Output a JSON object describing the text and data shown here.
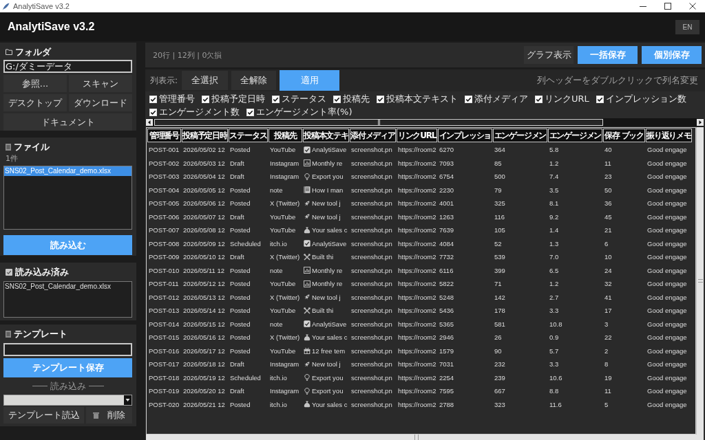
{
  "window": {
    "title": "AnalytiSave v3.2"
  },
  "header": {
    "title": "AnalytiSave v3.2",
    "language_button": "EN"
  },
  "sidebar": {
    "folder_panel": {
      "title": "フォルダ",
      "path": "G:/ダミーデータ",
      "buttons": [
        "参照...",
        "スキャン",
        "デスクトップ",
        "ダウンロード",
        "ドキュメント"
      ]
    },
    "file_panel": {
      "title": "ファイル",
      "count": "1件",
      "files": [
        {
          "name": "SNS02_Post_Calendar_demo.xlsx",
          "selected": true
        }
      ],
      "load_button": "読み込む"
    },
    "loaded_panel": {
      "title": "読み込み済み",
      "files": [
        "SNS02_Post_Calendar_demo.xlsx"
      ]
    },
    "template_panel": {
      "title": "テンプレート",
      "save_button": "テンプレート保存",
      "divider_label": "読み込み",
      "template_select": {
        "disabled": true
      },
      "load_button": "テンプレート読込",
      "delete_button": "削除"
    }
  },
  "summary": "20行 | 12列 | 0欠損",
  "toolbar_buttons": [
    {
      "label": "グラフ表示",
      "primary": false
    },
    {
      "label": "一括保存",
      "primary": true
    },
    {
      "label": "個別保存",
      "primary": true
    }
  ],
  "column_bar": {
    "label": "列表示:",
    "buttons": [
      {
        "label": "全選択",
        "primary": false
      },
      {
        "label": "全解除",
        "primary": false
      },
      {
        "label": "適用",
        "primary": true
      }
    ],
    "hint": "列ヘッダーをダブルクリックで列名変更"
  },
  "column_toggles": [
    {
      "label": "管理番号",
      "checked": true
    },
    {
      "label": "投稿予定日時",
      "checked": true
    },
    {
      "label": "ステータス",
      "checked": true
    },
    {
      "label": "投稿先",
      "checked": true
    },
    {
      "label": "投稿本文テキスト",
      "checked": true
    },
    {
      "label": "添付メディア",
      "checked": true
    },
    {
      "label": "リンクURL",
      "checked": true
    },
    {
      "label": "インプレッション数",
      "checked": true
    },
    {
      "label": "エンゲージメント数",
      "checked": true
    },
    {
      "label": "エンゲージメント率(%)",
      "checked": true
    }
  ],
  "table": {
    "columns": [
      "管理番号",
      "投稿予定日時",
      "ステータス",
      "投稿先",
      "投稿本文テキ",
      "添付メディア",
      "リンクURL",
      "インプレッショ",
      "エンゲージメン",
      "エンゲージメン",
      "保存 ブック",
      "振り返りメモ"
    ],
    "rows": [
      {
        "id": "POST-001",
        "scheduled": "2026/05/02 12",
        "status": "Posted",
        "channel": "YouTube",
        "body": {
          "kind": "check",
          "text": "AnalytiSave"
        },
        "media": "screenshot.pn",
        "link": "https://room2",
        "impressions": "6270",
        "engagements": "364",
        "engagement_rate": "5.8",
        "saves": "40",
        "memo": "Good engage"
      },
      {
        "id": "POST-002",
        "scheduled": "2026/05/03 12",
        "status": "Draft",
        "channel": "Instagram",
        "body": {
          "kind": "chart",
          "text": "Monthly re"
        },
        "media": "screenshot.pn",
        "link": "https://room2",
        "impressions": "7093",
        "engagements": "85",
        "engagement_rate": "1.2",
        "saves": "11",
        "memo": "Good engage"
      },
      {
        "id": "POST-003",
        "scheduled": "2026/05/04 12",
        "status": "Draft",
        "channel": "Instagram",
        "body": {
          "kind": "bulb",
          "text": "Export you"
        },
        "media": "screenshot.pn",
        "link": "https://room2",
        "impressions": "6754",
        "engagements": "500",
        "engagement_rate": "7.4",
        "saves": "23",
        "memo": "Good engage"
      },
      {
        "id": "POST-004",
        "scheduled": "2026/05/05 12",
        "status": "Posted",
        "channel": "note",
        "body": {
          "kind": "notebook",
          "text": "How I man"
        },
        "media": "screenshot.pn",
        "link": "https://room2",
        "impressions": "2230",
        "engagements": "79",
        "engagement_rate": "3.5",
        "saves": "50",
        "memo": "Good engage"
      },
      {
        "id": "POST-005",
        "scheduled": "2026/05/06 12",
        "status": "Posted",
        "channel": "X (Twitter)",
        "body": {
          "kind": "rocket",
          "text": "New tool j"
        },
        "media": "screenshot.pn",
        "link": "https://room2",
        "impressions": "4001",
        "engagements": "325",
        "engagement_rate": "8.1",
        "saves": "36",
        "memo": "Good engage"
      },
      {
        "id": "POST-006",
        "scheduled": "2026/05/07 12",
        "status": "Draft",
        "channel": "YouTube",
        "body": {
          "kind": "rocket",
          "text": "New tool j"
        },
        "media": "screenshot.pn",
        "link": "https://room2",
        "impressions": "1263",
        "engagements": "116",
        "engagement_rate": "9.2",
        "saves": "45",
        "memo": "Good engage"
      },
      {
        "id": "POST-007",
        "scheduled": "2026/05/08 12",
        "status": "Posted",
        "channel": "YouTube",
        "body": {
          "kind": "bag",
          "text": "Your sales c"
        },
        "media": "screenshot.pn",
        "link": "https://room2",
        "impressions": "7639",
        "engagements": "105",
        "engagement_rate": "1.4",
        "saves": "21",
        "memo": "Good engage"
      },
      {
        "id": "POST-008",
        "scheduled": "2026/05/09 12",
        "status": "Scheduled",
        "channel": "itch.io",
        "body": {
          "kind": "check",
          "text": "AnalytiSave"
        },
        "media": "screenshot.pn",
        "link": "https://room2",
        "impressions": "4084",
        "engagements": "52",
        "engagement_rate": "1.3",
        "saves": "6",
        "memo": "Good engage"
      },
      {
        "id": "POST-009",
        "scheduled": "2026/05/10 12",
        "status": "Draft",
        "channel": "X (Twitter)",
        "body": {
          "kind": "tools",
          "text": "Built thi"
        },
        "media": "screenshot.pn",
        "link": "https://room2",
        "impressions": "7732",
        "engagements": "539",
        "engagement_rate": "7.0",
        "saves": "10",
        "memo": "Good engage"
      },
      {
        "id": "POST-010",
        "scheduled": "2026/05/11 12",
        "status": "Posted",
        "channel": "note",
        "body": {
          "kind": "chart",
          "text": "Monthly re"
        },
        "media": "screenshot.pn",
        "link": "https://room2",
        "impressions": "6116",
        "engagements": "399",
        "engagement_rate": "6.5",
        "saves": "24",
        "memo": "Good engage"
      },
      {
        "id": "POST-011",
        "scheduled": "2026/05/12 12",
        "status": "Posted",
        "channel": "YouTube",
        "body": {
          "kind": "chart",
          "text": "Monthly re"
        },
        "media": "screenshot.pn",
        "link": "https://room2",
        "impressions": "5822",
        "engagements": "71",
        "engagement_rate": "1.2",
        "saves": "32",
        "memo": "Good engage"
      },
      {
        "id": "POST-012",
        "scheduled": "2026/05/13 12",
        "status": "Posted",
        "channel": "X (Twitter)",
        "body": {
          "kind": "rocket",
          "text": "New tool j"
        },
        "media": "screenshot.pn",
        "link": "https://room2",
        "impressions": "5248",
        "engagements": "142",
        "engagement_rate": "2.7",
        "saves": "41",
        "memo": "Good engage"
      },
      {
        "id": "POST-013",
        "scheduled": "2026/05/14 12",
        "status": "Posted",
        "channel": "YouTube",
        "body": {
          "kind": "tools",
          "text": "Built thi"
        },
        "media": "screenshot.pn",
        "link": "https://room2",
        "impressions": "5436",
        "engagements": "178",
        "engagement_rate": "3.3",
        "saves": "17",
        "memo": "Good engage"
      },
      {
        "id": "POST-014",
        "scheduled": "2026/05/15 12",
        "status": "Posted",
        "channel": "note",
        "body": {
          "kind": "check",
          "text": "AnalytiSave"
        },
        "media": "screenshot.pn",
        "link": "https://room2",
        "impressions": "5365",
        "engagements": "581",
        "engagement_rate": "10.8",
        "saves": "3",
        "memo": "Good engage"
      },
      {
        "id": "POST-015",
        "scheduled": "2026/05/16 12",
        "status": "Posted",
        "channel": "X (Twitter)",
        "body": {
          "kind": "bag",
          "text": "Your sales c"
        },
        "media": "screenshot.pn",
        "link": "https://room2",
        "impressions": "2946",
        "engagements": "26",
        "engagement_rate": "0.9",
        "saves": "22",
        "memo": "Good engage"
      },
      {
        "id": "POST-016",
        "scheduled": "2026/05/17 12",
        "status": "Posted",
        "channel": "YouTube",
        "body": {
          "kind": "gift",
          "text": "12 free tem"
        },
        "media": "screenshot.pn",
        "link": "https://room2",
        "impressions": "1579",
        "engagements": "90",
        "engagement_rate": "5.7",
        "saves": "2",
        "memo": "Good engage"
      },
      {
        "id": "POST-017",
        "scheduled": "2026/05/18 12",
        "status": "Draft",
        "channel": "Instagram",
        "body": {
          "kind": "rocket",
          "text": "New tool j"
        },
        "media": "screenshot.pn",
        "link": "https://room2",
        "impressions": "7031",
        "engagements": "232",
        "engagement_rate": "3.3",
        "saves": "8",
        "memo": "Good engage"
      },
      {
        "id": "POST-018",
        "scheduled": "2026/05/19 12",
        "status": "Scheduled",
        "channel": "itch.io",
        "body": {
          "kind": "bulb",
          "text": "Export you"
        },
        "media": "screenshot.pn",
        "link": "https://room2",
        "impressions": "2254",
        "engagements": "239",
        "engagement_rate": "10.6",
        "saves": "19",
        "memo": "Good engage"
      },
      {
        "id": "POST-019",
        "scheduled": "2026/05/20 12",
        "status": "Draft",
        "channel": "Instagram",
        "body": {
          "kind": "bulb",
          "text": "Export you"
        },
        "media": "screenshot.pn",
        "link": "https://room2",
        "impressions": "7595",
        "engagements": "667",
        "engagement_rate": "8.8",
        "saves": "11",
        "memo": "Good engage"
      },
      {
        "id": "POST-020",
        "scheduled": "2026/05/21 12",
        "status": "Posted",
        "channel": "itch.io",
        "body": {
          "kind": "bag",
          "text": "Your sales c"
        },
        "media": "screenshot.pn",
        "link": "https://room2",
        "impressions": "2788",
        "engagements": "323",
        "engagement_rate": "11.6",
        "saves": "5",
        "memo": "Good engage"
      }
    ]
  }
}
